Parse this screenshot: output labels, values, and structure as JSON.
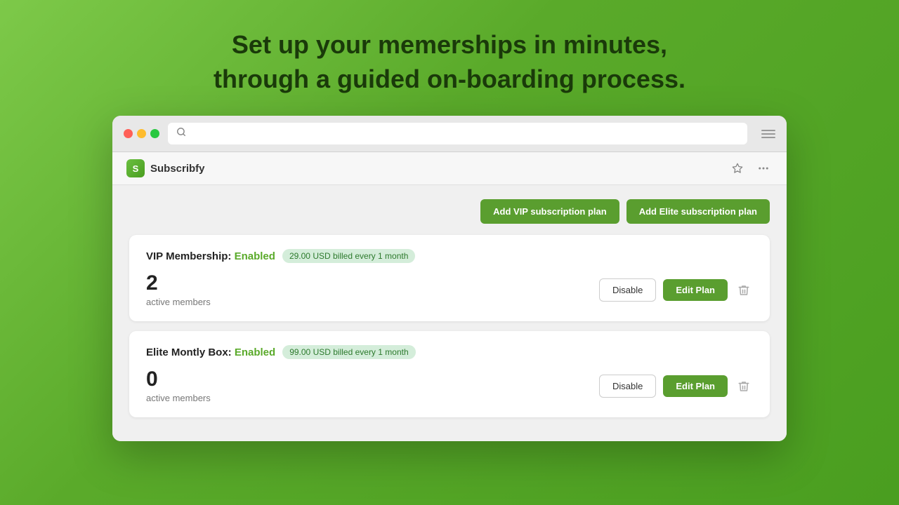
{
  "hero": {
    "line1": "Set up your memerships in minutes,",
    "line2": "through a guided on-boarding process."
  },
  "browser": {
    "search_placeholder": ""
  },
  "appbar": {
    "app_name": "Subscribfy",
    "logo_letter": "S"
  },
  "actions": {
    "add_vip_label": "Add VIP subscription plan",
    "add_elite_label": "Add Elite subscription plan"
  },
  "plans": [
    {
      "id": "vip",
      "title": "VIP Membership:",
      "status": "Enabled",
      "badge": "29.00 USD billed every 1 month",
      "count": "2",
      "count_label": "active members",
      "disable_label": "Disable",
      "edit_label": "Edit Plan"
    },
    {
      "id": "elite",
      "title": "Elite Montly Box:",
      "status": "Enabled",
      "badge": "99.00 USD billed every 1 month",
      "count": "0",
      "count_label": "active members",
      "disable_label": "Disable",
      "edit_label": "Edit Plan"
    }
  ],
  "icons": {
    "search": "🔍",
    "pin": "📌",
    "more": "•••",
    "trash": "🗑"
  }
}
